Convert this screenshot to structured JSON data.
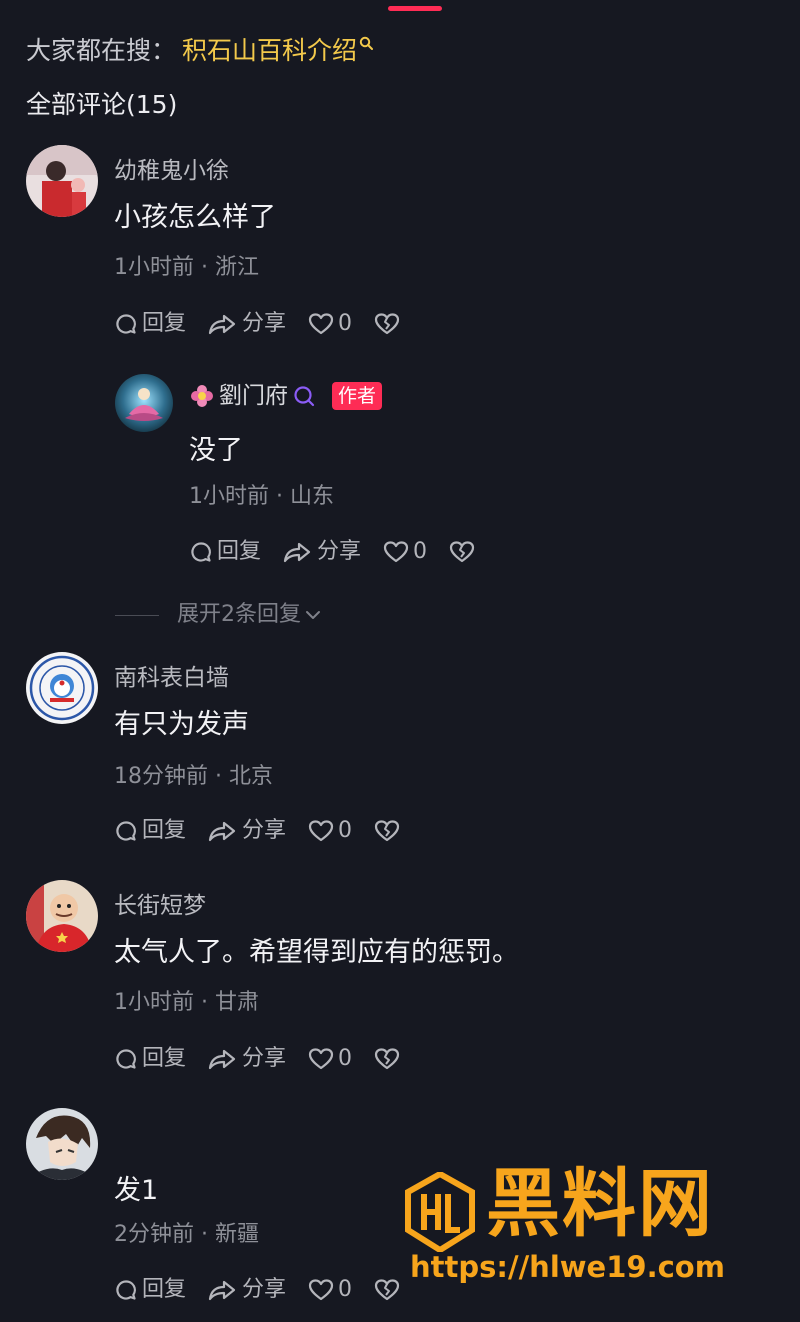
{
  "search_hint": {
    "prefix": "大家都在搜：",
    "query": "积石山百科介绍"
  },
  "comments_header": "全部评论(15)",
  "comments": [
    {
      "username": "幼稚鬼小徐",
      "text": "小孩怎么样了",
      "meta": "1小时前 · 浙江",
      "reply_label": "回复",
      "share_label": "分享",
      "likes": "0"
    },
    {
      "username": "南科表白墙",
      "text": "有只为发声",
      "meta": "18分钟前 · 北京",
      "reply_label": "回复",
      "share_label": "分享",
      "likes": "0"
    },
    {
      "username": "长街短梦",
      "text": "太气人了。希望得到应有的惩罚。",
      "meta": "1小时前 · 甘肃",
      "reply_label": "回复",
      "share_label": "分享",
      "likes": "0"
    },
    {
      "username": "",
      "text": "发1",
      "meta": "2分钟前 · 新疆",
      "reply_label": "回复",
      "share_label": "分享",
      "likes": "0"
    }
  ],
  "author_reply": {
    "username": "劉门府",
    "badge": "作者",
    "text": "没了",
    "meta": "1小时前 · 山东",
    "reply_label": "回复",
    "share_label": "分享",
    "likes": "0"
  },
  "expand_replies": "展开2条回复",
  "watermark": {
    "title": "黑料网",
    "url": "https://hlwe19.com"
  },
  "colors": {
    "background": "#161821",
    "accent": "#fe2c55",
    "search_query": "#f3c94b",
    "watermark": "#f7a51c"
  }
}
